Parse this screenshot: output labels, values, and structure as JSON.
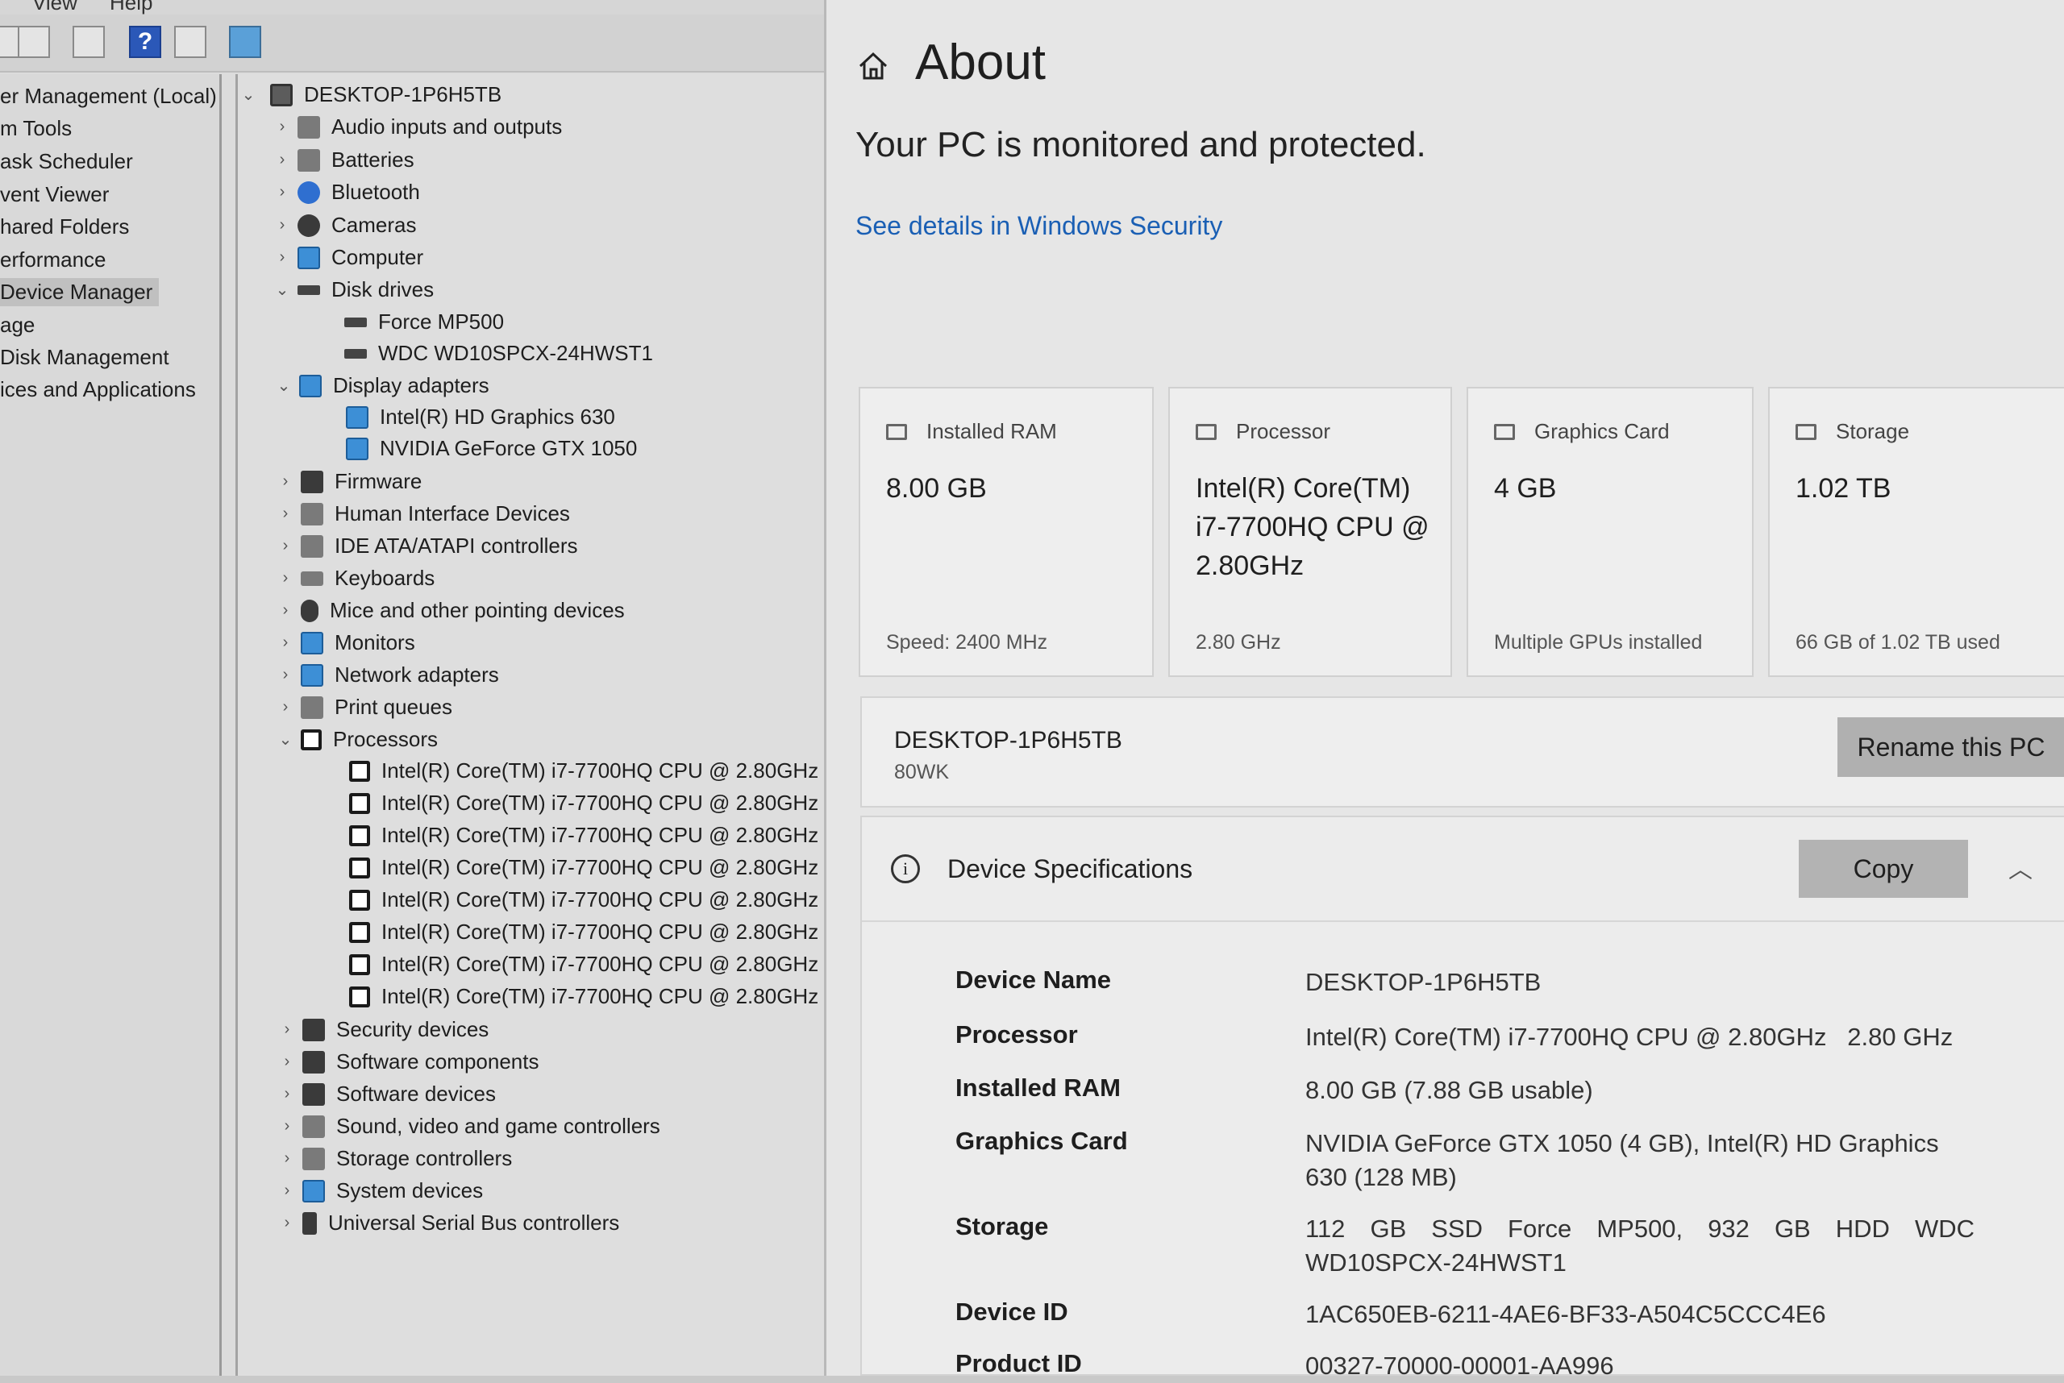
{
  "mmc": {
    "menu": [
      "View",
      "Help"
    ],
    "nav": [
      "er Management (Local)",
      "m Tools",
      "ask Scheduler",
      "vent Viewer",
      "hared Folders",
      "erformance",
      "Device Manager",
      "age",
      "Disk Management",
      "ices and Applications"
    ],
    "nav_selected": "Device Manager",
    "tree": {
      "root": "DESKTOP-1P6H5TB",
      "items": [
        {
          "label": "Audio inputs and outputs",
          "expanded": false
        },
        {
          "label": "Batteries",
          "expanded": false
        },
        {
          "label": "Bluetooth",
          "expanded": false
        },
        {
          "label": "Cameras",
          "expanded": false
        },
        {
          "label": "Computer",
          "expanded": false
        },
        {
          "label": "Disk drives",
          "expanded": true,
          "children": [
            "Force MP500",
            "WDC WD10SPCX-24HWST1"
          ]
        },
        {
          "label": "Display adapters",
          "expanded": true,
          "children": [
            "Intel(R) HD Graphics 630",
            "NVIDIA GeForce GTX 1050"
          ]
        },
        {
          "label": "Firmware",
          "expanded": false
        },
        {
          "label": "Human Interface Devices",
          "expanded": false
        },
        {
          "label": "IDE ATA/ATAPI controllers",
          "expanded": false
        },
        {
          "label": "Keyboards",
          "expanded": false
        },
        {
          "label": "Mice and other pointing devices",
          "expanded": false
        },
        {
          "label": "Monitors",
          "expanded": false
        },
        {
          "label": "Network adapters",
          "expanded": false
        },
        {
          "label": "Print queues",
          "expanded": false
        },
        {
          "label": "Processors",
          "expanded": true,
          "children": [
            "Intel(R) Core(TM) i7-7700HQ CPU @ 2.80GHz",
            "Intel(R) Core(TM) i7-7700HQ CPU @ 2.80GHz",
            "Intel(R) Core(TM) i7-7700HQ CPU @ 2.80GHz",
            "Intel(R) Core(TM) i7-7700HQ CPU @ 2.80GHz",
            "Intel(R) Core(TM) i7-7700HQ CPU @ 2.80GHz",
            "Intel(R) Core(TM) i7-7700HQ CPU @ 2.80GHz",
            "Intel(R) Core(TM) i7-7700HQ CPU @ 2.80GHz",
            "Intel(R) Core(TM) i7-7700HQ CPU @ 2.80GHz"
          ]
        },
        {
          "label": "Security devices",
          "expanded": false
        },
        {
          "label": "Software components",
          "expanded": false
        },
        {
          "label": "Software devices",
          "expanded": false
        },
        {
          "label": "Sound, video and game controllers",
          "expanded": false
        },
        {
          "label": "Storage controllers",
          "expanded": false
        },
        {
          "label": "System devices",
          "expanded": false
        },
        {
          "label": "Universal Serial Bus controllers",
          "expanded": false
        }
      ]
    }
  },
  "about": {
    "title": "About",
    "protection": "Your PC is monitored and protected.",
    "security_link": "See details in Windows Security",
    "cards": [
      {
        "title": "Installed RAM",
        "value": "8.00 GB",
        "sub": "Speed: 2400 MHz"
      },
      {
        "title": "Processor",
        "value": "Intel(R) Core(TM) i7-7700HQ CPU @ 2.80GHz",
        "sub": "2.80 GHz"
      },
      {
        "title": "Graphics Card",
        "value": "4 GB",
        "sub": "Multiple GPUs installed"
      },
      {
        "title": "Storage",
        "value": "1.02 TB",
        "sub": "66 GB of 1.02 TB used"
      }
    ],
    "pc_name": "DESKTOP-1P6H5TB",
    "pc_model": "80WK",
    "rename_label": "Rename this PC",
    "specs_title": "Device Specifications",
    "copy_label": "Copy",
    "specs": [
      {
        "label": "Device Name",
        "value": "DESKTOP-1P6H5TB"
      },
      {
        "label": "Processor",
        "value": "Intel(R) Core(TM) i7-7700HQ CPU @ 2.80GHz   2.80 GHz"
      },
      {
        "label": "Installed RAM",
        "value": "8.00 GB (7.88 GB usable)"
      },
      {
        "label": "Graphics Card",
        "value": "NVIDIA GeForce GTX 1050 (4 GB), Intel(R) HD Graphics 630 (128 MB)"
      },
      {
        "label": "Storage",
        "value": "112 GB SSD Force MP500, 932 GB HDD WDC WD10SPCX-24HWST1"
      },
      {
        "label": "Device ID",
        "value": "1AC650EB-6211-4AE6-BF33-A504C5CCC4E6"
      },
      {
        "label": "Product ID",
        "value": "00327-70000-00001-AA996"
      }
    ]
  }
}
